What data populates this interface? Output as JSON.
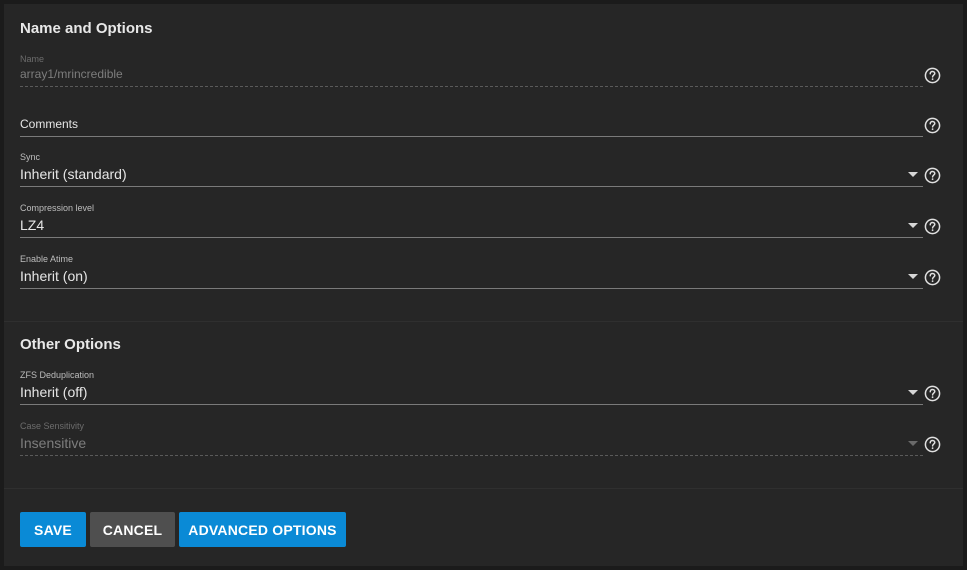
{
  "sections": {
    "name_options": {
      "title": "Name and Options"
    },
    "other_options": {
      "title": "Other Options"
    }
  },
  "fields": {
    "name": {
      "label": "Name",
      "value": "array1/mrincredible",
      "disabled": true
    },
    "comments": {
      "label": "Comments",
      "value": ""
    },
    "sync": {
      "label": "Sync",
      "value": "Inherit (standard)"
    },
    "compression": {
      "label": "Compression level",
      "value": "LZ4"
    },
    "atime": {
      "label": "Enable Atime",
      "value": "Inherit (on)"
    },
    "dedup": {
      "label": "ZFS Deduplication",
      "value": "Inherit (off)"
    },
    "case_sensitivity": {
      "label": "Case Sensitivity",
      "value": "Insensitive",
      "disabled": true
    }
  },
  "buttons": {
    "save": "SAVE",
    "cancel": "CANCEL",
    "advanced": "ADVANCED OPTIONS"
  },
  "colors": {
    "background": "#1b1b1b",
    "card": "#262626",
    "primary": "#0a8ad6",
    "secondary": "#4f4f4f",
    "text": "#e6e6e6",
    "muted": "#7d7d7d"
  },
  "icons": {
    "help": "help-circle-icon",
    "dropdown": "chevron-down-icon"
  }
}
